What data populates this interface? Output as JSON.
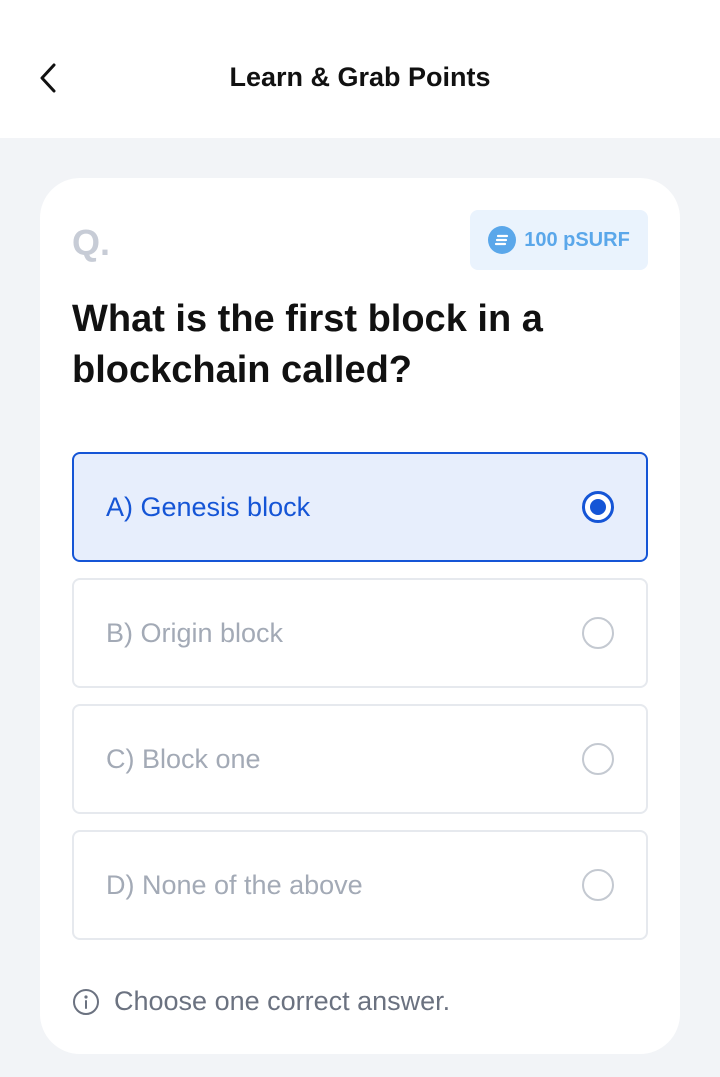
{
  "header": {
    "title": "Learn & Grab Points",
    "back_icon": "chevron-left-icon"
  },
  "quiz": {
    "q_mark": "Q.",
    "points_label": "100 pSURF",
    "points_icon": "psurf-coin-icon",
    "question": "What is the first block in a blockchain called?",
    "options": [
      {
        "label": "A) Genesis block",
        "selected": true
      },
      {
        "label": "B) Origin block",
        "selected": false
      },
      {
        "label": "C) Block one",
        "selected": false
      },
      {
        "label": "D) None of the above",
        "selected": false
      }
    ],
    "hint_icon": "info-icon",
    "hint": "Choose one correct answer."
  },
  "colors": {
    "accent": "#1555d6",
    "selected_bg": "#e7eefc",
    "badge_bg": "#eaf3fd",
    "badge_text": "#5aa7ea",
    "page_bg": "#f2f4f7"
  }
}
